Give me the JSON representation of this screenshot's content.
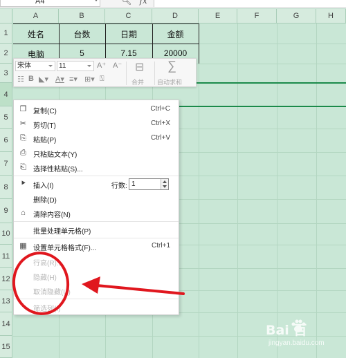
{
  "formula_bar": {
    "name_box": "A4",
    "zoom_icon": "zoom-icon",
    "fx_label": "fx"
  },
  "columns": [
    "A",
    "B",
    "C",
    "D",
    "E",
    "F",
    "G",
    "H"
  ],
  "rows": [
    "1",
    "2",
    "3",
    "4",
    "5",
    "6",
    "7",
    "8",
    "9",
    "10",
    "11",
    "12",
    "13",
    "14",
    "15"
  ],
  "table": {
    "header": [
      "姓名",
      "台数",
      "日期",
      "金额"
    ],
    "row1": [
      "电脑",
      "5",
      "7.15",
      "20000"
    ]
  },
  "mini_toolbar": {
    "font_name": "宋体",
    "font_size": "11",
    "grow_font": "A⁺",
    "shrink_font": "A⁻",
    "bold": "B",
    "merge_label": "合并",
    "autosum_label": "自动求和"
  },
  "context_menu": {
    "items": [
      {
        "icon": "copy-icon",
        "label": "复制(C)",
        "shortcut": "Ctrl+C"
      },
      {
        "icon": "cut-icon",
        "label": "剪切(T)",
        "shortcut": "Ctrl+X"
      },
      {
        "icon": "paste-icon",
        "label": "粘贴(P)",
        "shortcut": "Ctrl+V"
      },
      {
        "icon": "paste-text-icon",
        "label": "只粘贴文本(Y)"
      },
      {
        "icon": "paste-special-icon",
        "label": "选择性粘贴(S)..."
      },
      {
        "icon": "insert-icon",
        "label": "插入(I)"
      },
      {
        "label": "删除(D)"
      },
      {
        "icon": "eraser-icon",
        "label": "清除内容(N)"
      },
      {
        "label": "批量处理单元格(P)"
      },
      {
        "icon": "format-cells-icon",
        "label": "设置单元格格式(F)...",
        "shortcut": "Ctrl+1"
      },
      {
        "label": "行高(R)..."
      },
      {
        "label": "隐藏(H)"
      },
      {
        "label": "取消隐藏(U)"
      },
      {
        "label": "筛选列(I)"
      }
    ],
    "rows_label": "行数:",
    "rows_value": "1"
  },
  "watermark": {
    "brand": "Bai  百",
    "sub": "jingyan.baidu.com"
  },
  "colors": {
    "sheet_bg": "#c9e7d6",
    "selection": "#1b8a4a",
    "annotation_red": "#e0171e"
  }
}
